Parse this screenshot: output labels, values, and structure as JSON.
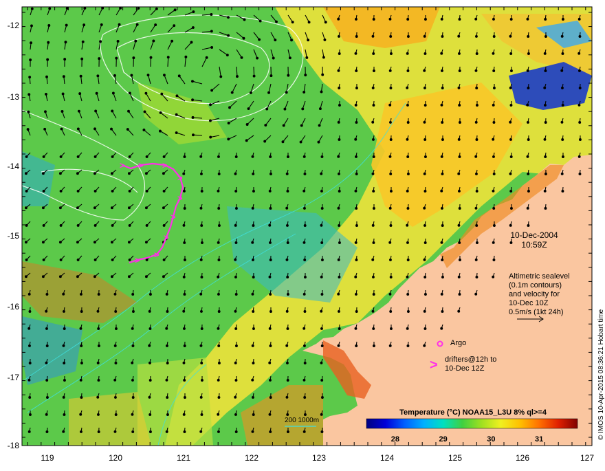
{
  "map": {
    "lon_range": [
      118.6,
      127.0
    ],
    "lat_range": [
      -18.0,
      -11.65
    ],
    "lon_ticks": [
      "119",
      "120",
      "121",
      "122",
      "123",
      "124",
      "125",
      "126",
      "127"
    ],
    "lat_ticks": [
      "-12",
      "-13",
      "-14",
      "-15",
      "-16",
      "-17",
      "-18"
    ],
    "land_color": "#fac6a0",
    "drifter_color": "#ff30e8",
    "current_arrow_color": "#000000",
    "contour_color": "#ffffff"
  },
  "labels": {
    "date": "10-Dec-2004",
    "time": "10:59Z",
    "sealevel_lines": [
      "Altimetric sealevel",
      "(0.1m contours)",
      "and velocity for",
      "10-Dec 10Z",
      "0.5m/s (1kt 24h)"
    ],
    "argo_label": "Argo",
    "drifter_lines": [
      "drifters@12h to",
      "10-Dec 12Z"
    ],
    "drifter_marker": ">",
    "isobath_label": "200  1000m",
    "copyright": "© IMOS 10-Apr-2015 08:36:21 Hobart time"
  },
  "colorbar": {
    "title": "Temperature (°C) NOAA15_L3U 8% ql>=4",
    "range": [
      27.4,
      31.8
    ],
    "ticks": [
      "28",
      "29",
      "30",
      "31"
    ],
    "stops": [
      "#000080",
      "#0000d8",
      "#0060ff",
      "#00b0ff",
      "#00e0c0",
      "#40d040",
      "#a0e020",
      "#f0f020",
      "#ffc000",
      "#ff7000",
      "#e02000",
      "#800000"
    ]
  }
}
